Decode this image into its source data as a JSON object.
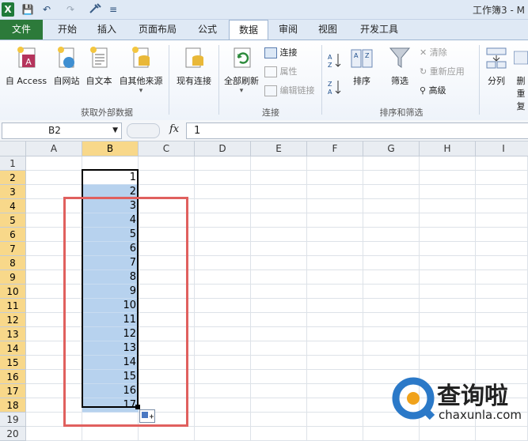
{
  "window": {
    "title": "工作簿3 - M"
  },
  "quick_access": {
    "excel_logo": "X",
    "save": "💾",
    "undo": "↶",
    "redo": "↷",
    "customize": "≡"
  },
  "tabs": [
    {
      "label": "文件",
      "active": false,
      "file": true
    },
    {
      "label": "开始",
      "active": false
    },
    {
      "label": "插入",
      "active": false
    },
    {
      "label": "页面布局",
      "active": false
    },
    {
      "label": "公式",
      "active": false
    },
    {
      "label": "数据",
      "active": true
    },
    {
      "label": "审阅",
      "active": false
    },
    {
      "label": "视图",
      "active": false
    },
    {
      "label": "开发工具",
      "active": false
    }
  ],
  "ribbon": {
    "get_external": {
      "group_label": "获取外部数据",
      "from_access": "自 Access",
      "from_web": "自网站",
      "from_text": "自文本",
      "from_other": "自其他来源",
      "existing": "现有连接"
    },
    "connections": {
      "group_label": "连接",
      "refresh_all": "全部刷新",
      "connections": "连接",
      "properties": "属性",
      "edit_links": "编辑链接"
    },
    "sort_filter": {
      "group_label": "排序和筛选",
      "sort": "排序",
      "filter": "筛选",
      "clear": "清除",
      "reapply": "重新应用",
      "advanced": "高级"
    },
    "data_tools": {
      "split": "分列",
      "remove_dup_top": "删",
      "remove_dup_bottom": "重复"
    }
  },
  "formula_bar": {
    "name_box": "B2",
    "fx_label": "fx",
    "value": "1"
  },
  "grid": {
    "columns": [
      "A",
      "B",
      "C",
      "D",
      "E",
      "F",
      "G",
      "H",
      "I"
    ],
    "rows": [
      "1",
      "2",
      "3",
      "4",
      "5",
      "6",
      "7",
      "8",
      "9",
      "10",
      "11",
      "12",
      "13",
      "14",
      "15",
      "16",
      "17",
      "18",
      "19",
      "20"
    ],
    "b_values": [
      "1",
      "2",
      "3",
      "4",
      "5",
      "6",
      "7",
      "8",
      "9",
      "10",
      "11",
      "12",
      "13",
      "14",
      "15",
      "16",
      "17"
    ]
  },
  "watermark": {
    "brand": "查询啦",
    "site": "chaxunla.com"
  },
  "colors": {
    "selection_fill": "#b7d2ee",
    "header_selected": "#f8d88a",
    "red_box": "#e0605e",
    "file_tab": "#2c7a3a"
  }
}
